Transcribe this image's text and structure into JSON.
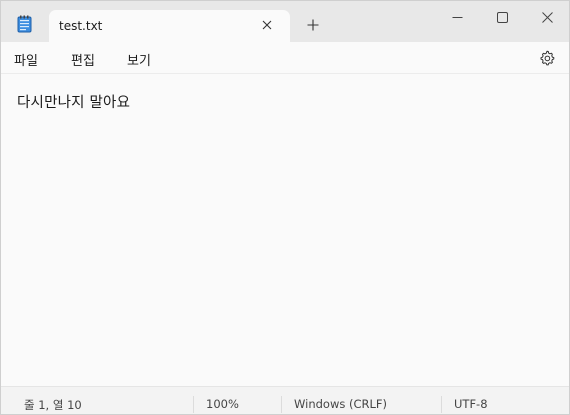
{
  "tab": {
    "title": "test.txt"
  },
  "menu": {
    "file": "파일",
    "edit": "편집",
    "view": "보기"
  },
  "editor": {
    "content": "다시만나지 말아요"
  },
  "status": {
    "position": "줄 1, 열 10",
    "zoom": "100%",
    "line_ending": "Windows (CRLF)",
    "encoding": "UTF-8"
  },
  "icons": {
    "app": "notepad-icon",
    "tab_close": "close-icon",
    "new_tab": "plus-icon",
    "minimize": "minimize-icon",
    "maximize": "maximize-icon",
    "close": "close-icon",
    "settings": "gear-icon"
  },
  "colors": {
    "titlebar": "#e8e8e8",
    "editor_bg": "#fafafa",
    "statusbar": "#f3f3f3",
    "app_icon_blue": "#2f7fd4"
  }
}
